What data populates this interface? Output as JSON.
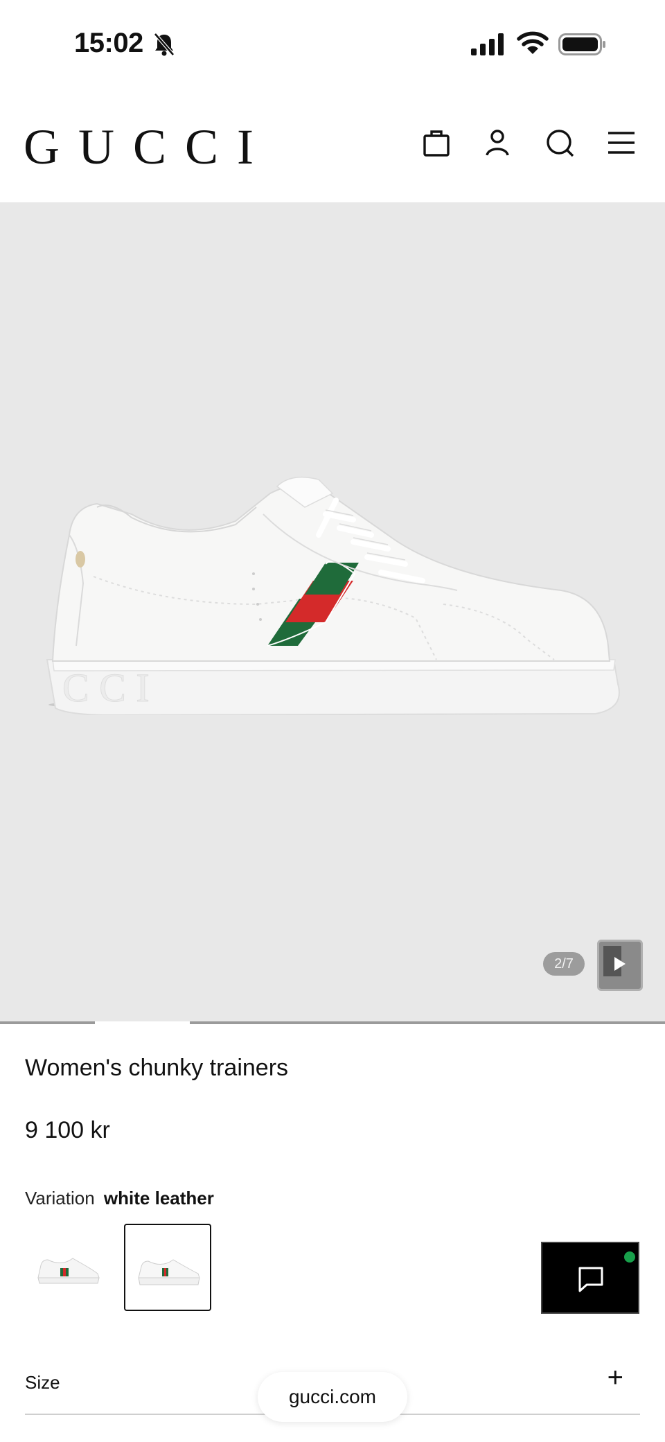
{
  "status_bar": {
    "time": "15:02"
  },
  "header": {
    "logo": "GUCCI"
  },
  "gallery": {
    "counter": "2/7",
    "current_slide": 2,
    "total_slides": 7
  },
  "product": {
    "title": "Women's chunky trainers",
    "price": "9 100 kr",
    "variation_label": "Variation",
    "variation_value": "white leather"
  },
  "size": {
    "label": "Size",
    "expand": "+"
  },
  "browser": {
    "url": "gucci.com"
  },
  "colors": {
    "gallery_bg": "#e8e8e8",
    "web_green": "#1f6b3a",
    "web_red": "#d42a2a",
    "chat_bg": "#000000",
    "chat_status": "#18a04b"
  },
  "icons": [
    "bell-off-icon",
    "signal-icon",
    "wifi-icon",
    "battery-icon",
    "bag-icon",
    "account-icon",
    "search-icon",
    "menu-icon",
    "play-icon",
    "chat-icon"
  ]
}
